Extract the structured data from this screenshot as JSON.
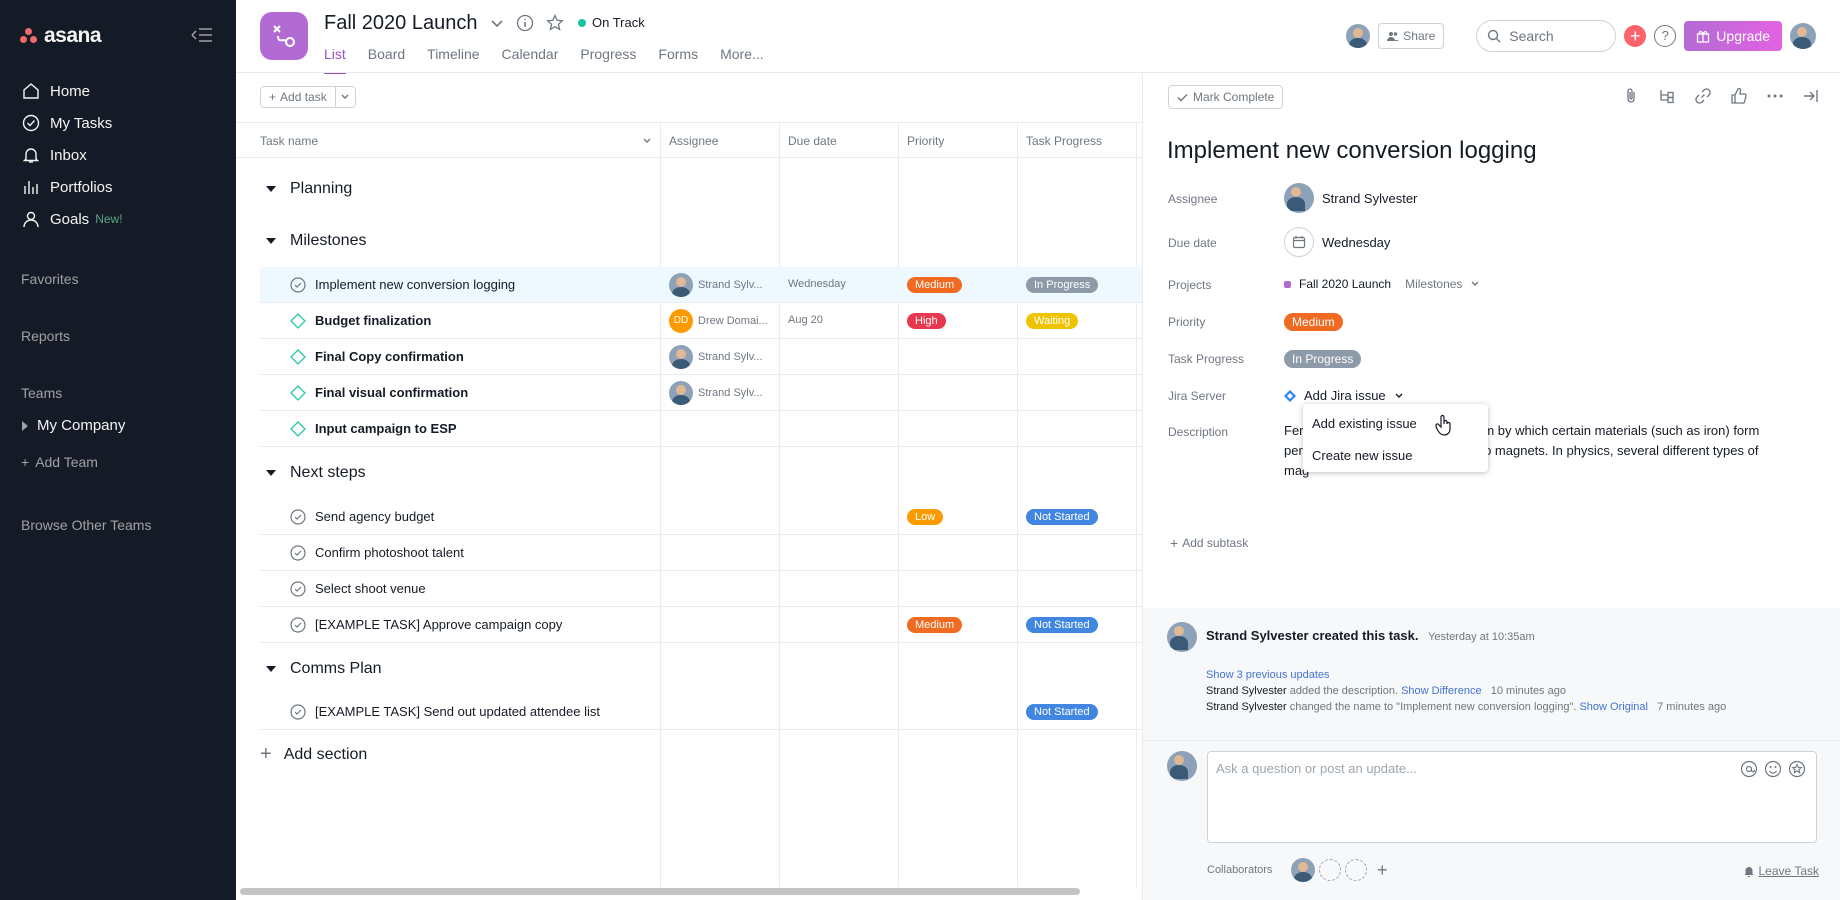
{
  "sidebar": {
    "brand": "asana",
    "nav": [
      {
        "label": "Home",
        "icon": "home-icon"
      },
      {
        "label": "My Tasks",
        "icon": "check-circle-icon"
      },
      {
        "label": "Inbox",
        "icon": "bell-icon"
      },
      {
        "label": "Portfolios",
        "icon": "bar-chart-icon"
      },
      {
        "label": "Goals",
        "icon": "person-icon",
        "badge": "New!"
      }
    ],
    "favorites": "Favorites",
    "reports": "Reports",
    "teams": "Teams",
    "team_name": "My Company",
    "add_team": "Add Team",
    "browse_teams": "Browse Other Teams"
  },
  "header": {
    "project_title": "Fall 2020 Launch",
    "status": "On Track",
    "status_color": "#19c2a0",
    "tabs": [
      "List",
      "Board",
      "Timeline",
      "Calendar",
      "Progress",
      "Forms",
      "More..."
    ],
    "active_tab": "List",
    "share": "Share",
    "search_placeholder": "Search",
    "upgrade": "Upgrade",
    "help": "?"
  },
  "list": {
    "add_task": "Add task",
    "columns": [
      "Task name",
      "Assignee",
      "Due date",
      "Priority",
      "Task Progress"
    ],
    "sections": {
      "planning": "Planning",
      "milestones": "Milestones",
      "next_steps": "Next steps",
      "comms_plan": "Comms Plan"
    },
    "tasks": [
      {
        "name": "Implement new conversion logging",
        "assignee": "Strand Sylv...",
        "due": "Wednesday",
        "priority": "Medium",
        "progress": "In Progress"
      },
      {
        "name": "Budget finalization",
        "assignee": "Drew Domai...",
        "assignee_initials": "DD",
        "due": "Aug 20",
        "priority": "High",
        "progress": "Waiting"
      },
      {
        "name": "Final Copy confirmation",
        "assignee": "Strand Sylv..."
      },
      {
        "name": "Final visual confirmation",
        "assignee": "Strand Sylv..."
      },
      {
        "name": "Input campaign to ESP"
      },
      {
        "name": "Send agency budget",
        "priority": "Low",
        "progress": "Not Started"
      },
      {
        "name": "Confirm photoshoot talent"
      },
      {
        "name": "Select shoot venue"
      },
      {
        "name": "[EXAMPLE TASK] Approve campaign copy",
        "priority": "Medium",
        "progress": "Not Started"
      },
      {
        "name": "[EXAMPLE TASK] Send out updated attendee list",
        "progress": "Not Started"
      }
    ],
    "add_section": "Add section",
    "colors": {
      "Medium": "#f06a22",
      "High": "#e8384f",
      "Low": "#fd9a00",
      "In Progress": "#8d9aa7",
      "Waiting": "#eec300",
      "Not Started": "#4186e0"
    }
  },
  "detail": {
    "mark_complete": "Mark Complete",
    "title": "Implement new conversion logging",
    "labels": {
      "assignee": "Assignee",
      "due": "Due date",
      "projects": "Projects",
      "priority": "Priority",
      "progress": "Task Progress",
      "jira": "Jira Server",
      "description": "Description"
    },
    "assignee": "Strand Sylvester",
    "due": "Wednesday",
    "project": "Fall 2020 Launch",
    "project_section": "Milestones",
    "priority": "Medium",
    "progress": "In Progress",
    "jira": "Add Jira issue",
    "description_l1": "Fer",
    "description_l1b": "anism by which certain materials (such as iron) form",
    "description_l2": "per",
    "description_l2b": "ted to magnets. In physics, several different types of",
    "description_l3": "mag",
    "dropdown": [
      "Add existing issue",
      "Create new issue"
    ],
    "add_subtask": "Add subtask",
    "activity": {
      "creator": "Strand Sylvester created this task.",
      "creator_time": "Yesterday at 10:35am",
      "show_prev": "Show 3 previous updates",
      "u1_actor": "Strand Sylvester",
      "u1_action": " added the description. ",
      "u1_link": "Show Difference",
      "u1_time": "10 minutes ago",
      "u2_actor": "Strand Sylvester",
      "u2_action": " changed the name to \"Implement new conversion logging\". ",
      "u2_link": "Show Original",
      "u2_time": "7 minutes ago"
    },
    "comment_placeholder": "Ask a question or post an update...",
    "collaborators": "Collaborators",
    "leave_task": "Leave Task"
  }
}
